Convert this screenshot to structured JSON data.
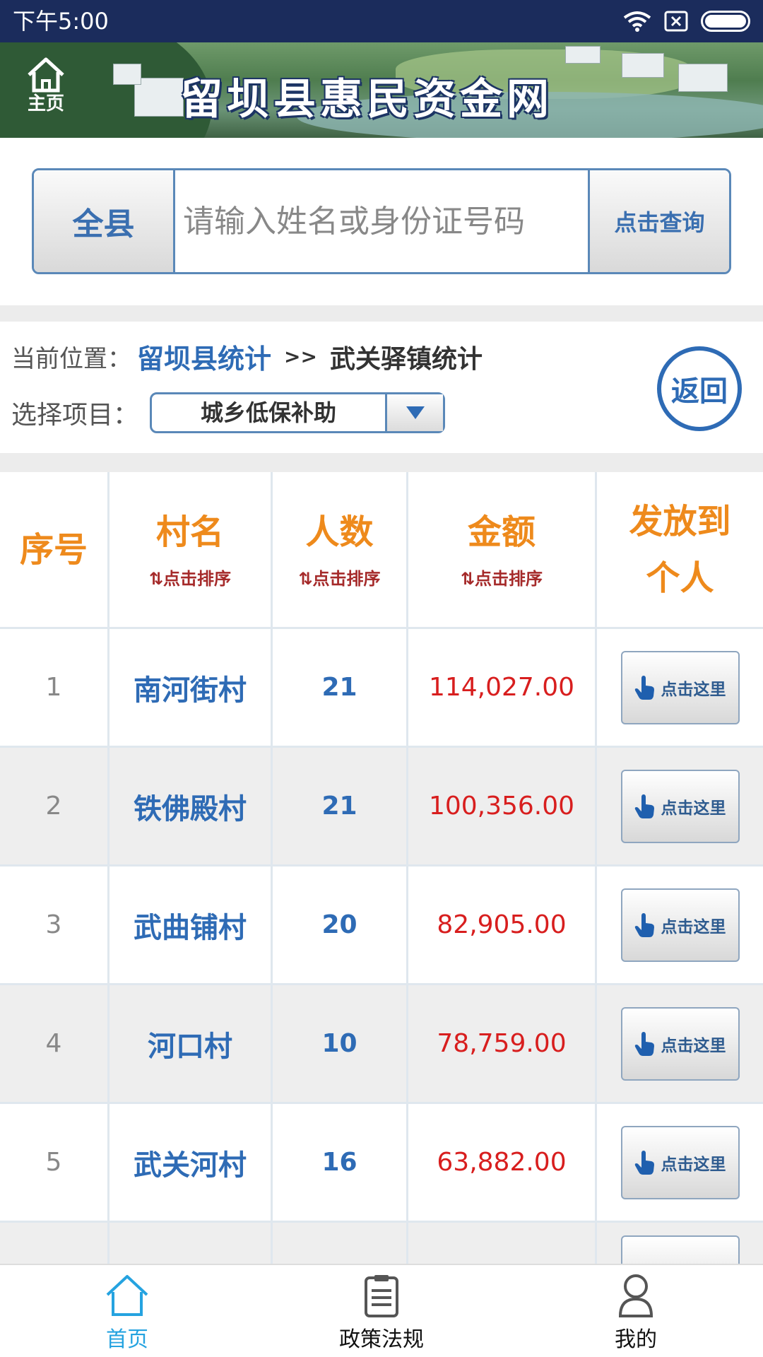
{
  "status_bar": {
    "time": "下午5:00"
  },
  "header": {
    "home_label": "主页",
    "title": "留坝县惠民资金网"
  },
  "search": {
    "scope_label": "全县",
    "placeholder": "请输入姓名或身份证号码",
    "query_label": "点击查询"
  },
  "location": {
    "prefix": "当前位置：",
    "parent": "留坝县统计",
    "separator": ">>",
    "current": "武关驿镇统计",
    "item_label": "选择项目：",
    "selected_item": "城乡低保补助",
    "back_label": "返回"
  },
  "table": {
    "headers": {
      "index": "序号",
      "village": "村名",
      "people": "人数",
      "amount": "金额",
      "personal_line1": "发放到",
      "personal_line2": "个人",
      "sort_hint": "⇅点击排序"
    },
    "button_label": "点击这里",
    "rows": [
      {
        "index": "1",
        "village": "南河街村",
        "people": "21",
        "amount": "114,027.00"
      },
      {
        "index": "2",
        "village": "铁佛殿村",
        "people": "21",
        "amount": "100,356.00"
      },
      {
        "index": "3",
        "village": "武曲铺村",
        "people": "20",
        "amount": "82,905.00"
      },
      {
        "index": "4",
        "village": "河口村",
        "people": "10",
        "amount": "78,759.00"
      },
      {
        "index": "5",
        "village": "武关河村",
        "people": "16",
        "amount": "63,882.00"
      }
    ]
  },
  "bottom_nav": {
    "items": [
      {
        "label": "首页",
        "icon": "home-icon"
      },
      {
        "label": "政策法规",
        "icon": "clipboard-icon"
      },
      {
        "label": "我的",
        "icon": "user-icon"
      }
    ]
  },
  "colors": {
    "accent": "#2e6bb5",
    "header_orange": "#ee8a1c",
    "amount_red": "#d81e1e",
    "status_bar": "#1b2c5c",
    "nav_active": "#25a3e0"
  }
}
